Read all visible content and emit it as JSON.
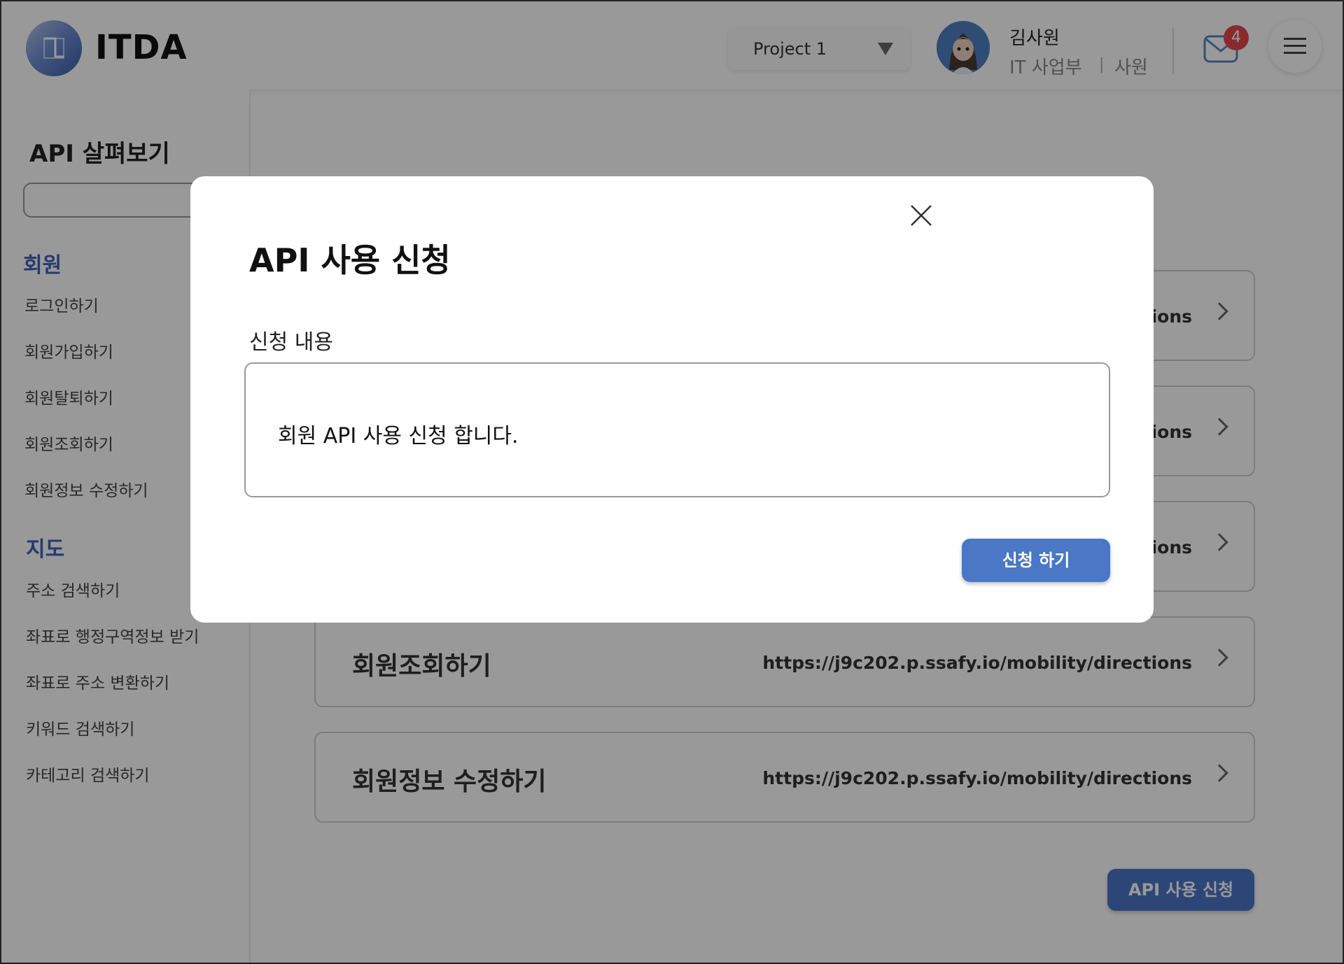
{
  "header": {
    "logo_text": "ITDA",
    "project_select": "Project 1",
    "user": {
      "name": "김사원",
      "department": "IT 사업부",
      "separator": "|",
      "role": "사원"
    },
    "mail_badge_count": "4"
  },
  "sidebar": {
    "title": "API 살펴보기",
    "search_placeholder": "",
    "sections": [
      {
        "heading": "회원",
        "items": [
          "로그인하기",
          "회원가입하기",
          "회원탈퇴하기",
          "회원조회하기",
          "회원정보 수정하기"
        ]
      },
      {
        "heading": "지도",
        "items": [
          "주소 검색하기",
          "좌표로 행정구역정보 받기",
          "좌표로 주소 변환하기",
          "키워드 검색하기",
          "카테고리 검색하기"
        ]
      }
    ]
  },
  "main": {
    "api_cards": [
      {
        "name": "",
        "url": "tions"
      },
      {
        "name": "",
        "url": "tions"
      },
      {
        "name": "",
        "url": "tions"
      },
      {
        "name": "회원조회하기",
        "url": "https://j9c202.p.ssafy.io/mobility/directions"
      },
      {
        "name": "회원정보 수정하기",
        "url": "https://j9c202.p.ssafy.io/mobility/directions"
      }
    ],
    "apply_button": "API 사용 신청"
  },
  "modal": {
    "title": "API 사용 신청",
    "label": "신청 내용",
    "textarea_value": "회원 API 사용 신청 합니다.",
    "submit_button": "신청 하기"
  },
  "colors": {
    "accent": "#4a77c6",
    "section_heading": "#3d64b8",
    "badge": "#e5484d",
    "overlay": "rgba(0,0,0,0.40)"
  }
}
